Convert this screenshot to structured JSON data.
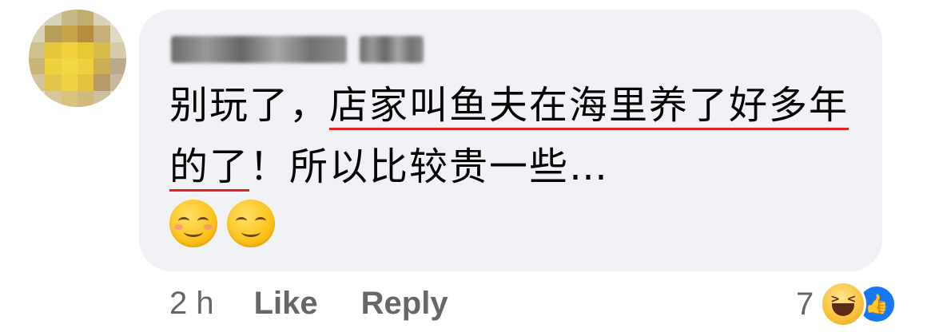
{
  "comment": {
    "author_name": "Pongpong Tan",
    "text_before_highlight": "别玩了，",
    "text_highlight": "店家叫鱼夫在海里养了好多年的了",
    "text_after_highlight": "！所以比较贵一些…",
    "emojis": [
      "relieved-blushing-emoji",
      "relieved-face-emoji"
    ]
  },
  "actions": {
    "time": "2 h",
    "like_label": "Like",
    "reply_label": "Reply"
  },
  "reactions": {
    "count": "7",
    "icons": [
      "haha-icon",
      "like-icon"
    ]
  },
  "colors": {
    "bubble_bg": "#f0f2f5",
    "text": "#050505",
    "meta": "#65676b",
    "highlight_underline": "#e02424",
    "like_blue": "#1877f2"
  }
}
